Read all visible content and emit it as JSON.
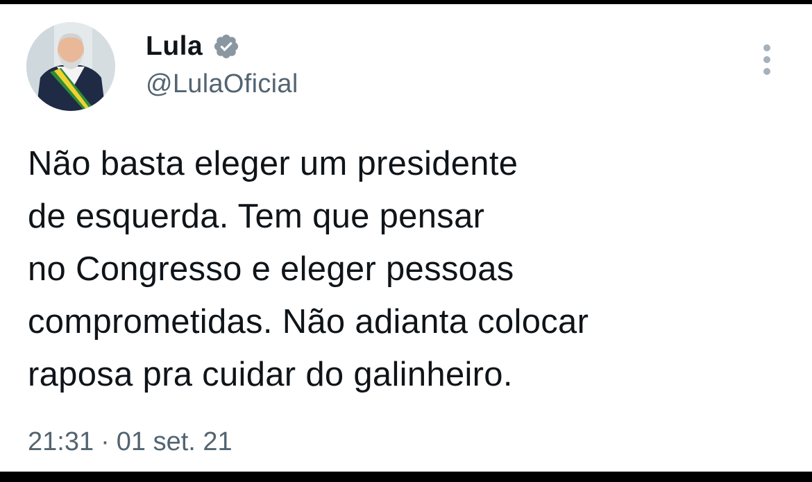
{
  "author": {
    "display_name": "Lula",
    "handle": "@LulaOficial",
    "verified_icon": "verified-badge-icon",
    "avatar_icon": "profile-avatar"
  },
  "tweet": {
    "lines": [
      "Não basta eleger um presidente",
      "de esquerda. Tem que pensar",
      "no Congresso e eleger pessoas",
      "comprometidas. Não adianta colocar",
      "raposa pra cuidar do galinheiro."
    ]
  },
  "meta": {
    "time": "21:31",
    "separator": "·",
    "date": "01 set. 21"
  },
  "menu": {
    "icon": "more-vertical-icon"
  },
  "colors": {
    "text": "#0f1419",
    "secondary": "#536471",
    "verified": "#8a96a0",
    "background": "#ffffff",
    "frame": "#000000"
  }
}
